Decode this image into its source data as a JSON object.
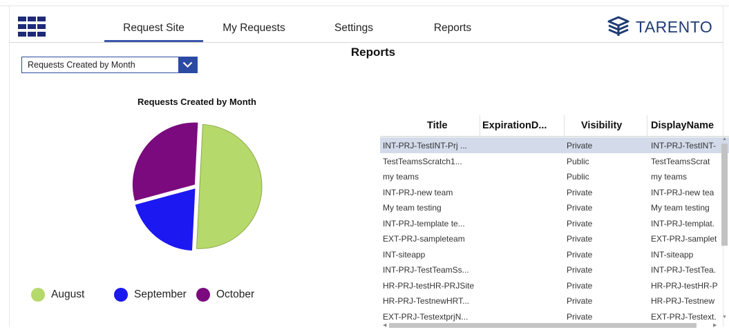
{
  "nav": {
    "tabs": [
      {
        "label": "Request Site",
        "active": true
      },
      {
        "label": "My Requests",
        "active": false
      },
      {
        "label": "Settings",
        "active": false
      },
      {
        "label": "Reports",
        "active": false
      }
    ]
  },
  "brand": {
    "name": "TARENTO",
    "color": "#1f3c73",
    "icon": "tarento-logo-icon"
  },
  "page": {
    "title": "Reports"
  },
  "report_select": {
    "value": "Requests Created by Month"
  },
  "chart_data": {
    "type": "pie",
    "title": "Requests Created by Month",
    "categories": [
      "August",
      "September",
      "October"
    ],
    "values": [
      50,
      20,
      30
    ],
    "colors": [
      "#b6d96b",
      "#1c18f2",
      "#7b0a7e"
    ],
    "legend_position": "bottom"
  },
  "table": {
    "columns": [
      "Title",
      "ExpirationD...",
      "Visibility",
      "DisplayName"
    ],
    "rows": [
      [
        "INT-PRJ-TestINT-Prj ...",
        "",
        "Private",
        "INT-PRJ-TestINT-"
      ],
      [
        "TestTeamsScratch1...",
        "",
        "Public",
        "TestTeamsScrat"
      ],
      [
        "my teams",
        "",
        "Public",
        "my teams"
      ],
      [
        "INT-PRJ-new team",
        "",
        "Private",
        "INT-PRJ-new tea"
      ],
      [
        "My team testing",
        "",
        "Private",
        "My team testing"
      ],
      [
        "INT-PRJ-template te...",
        "",
        "Private",
        "INT-PRJ-templat."
      ],
      [
        "EXT-PRJ-sampleteam",
        "",
        "Private",
        "EXT-PRJ-samplet"
      ],
      [
        "INT-siteapp",
        "",
        "Private",
        "INT-siteapp"
      ],
      [
        "INT-PRJ-TestTeamSs...",
        "",
        "Private",
        "INT-PRJ-TestTea."
      ],
      [
        "HR-PRJ-testHR-PRJSite",
        "",
        "Private",
        "HR-PRJ-testHR-P"
      ],
      [
        "HR-PRJ-TestnewHRT...",
        "",
        "Private",
        "HR-PRJ-Testnew"
      ],
      [
        "EXT-PRJ-TestextprjN...",
        "",
        "Private",
        "EXT-PRJ-Testext."
      ]
    ],
    "selected_row": 0
  },
  "colors": {
    "accent": "#2b4aa3",
    "waffle": "#1e2a78",
    "selected_row": "#d3dbea"
  }
}
